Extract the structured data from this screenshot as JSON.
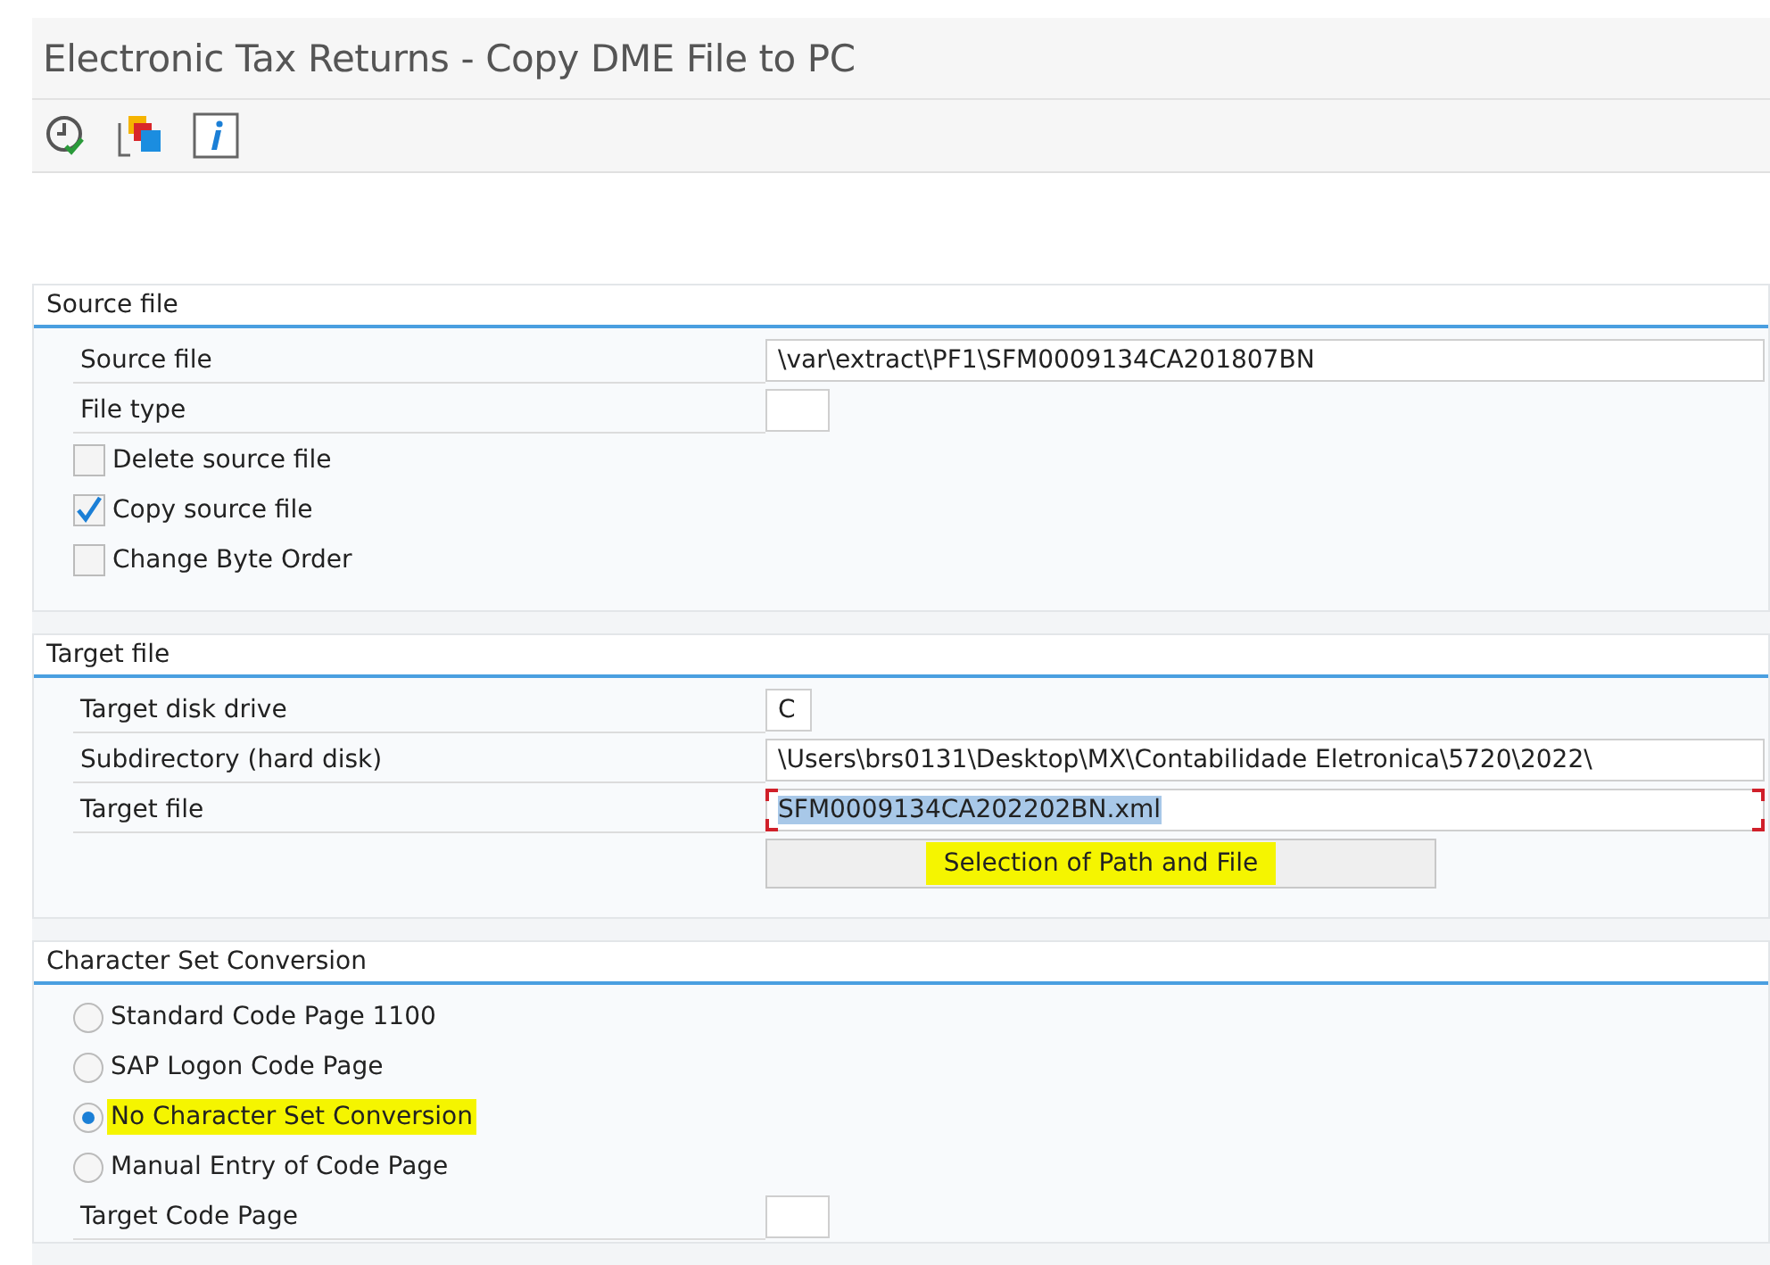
{
  "window": {
    "title": "Electronic Tax Returns - Copy DME File to PC"
  },
  "sections": [
    {
      "title": "Source file",
      "rows": [
        {
          "kind": "field",
          "label": "Source file",
          "value": "\\var\\extract\\PF1\\SFM0009134CA201807BN"
        },
        {
          "kind": "short_field",
          "label": "File type"
        },
        {
          "kind": "checkbox",
          "label": "Delete source file",
          "checked": false
        },
        {
          "kind": "checkbox",
          "label": "Copy source file",
          "checked": true
        },
        {
          "kind": "checkbox",
          "label": "Change Byte Order",
          "checked": false
        }
      ]
    },
    {
      "title": "Target file",
      "rows": [
        {
          "kind": "short_field",
          "label": "Target disk drive",
          "value": "C"
        },
        {
          "kind": "field",
          "label": "Subdirectory (hard disk)",
          "value": "\\Users\\brs0131\\Desktop\\MX\\Contabilidade Eletronica\\5720\\2022\\"
        },
        {
          "kind": "field",
          "label": "Target file",
          "value": "SFM0009134CA202202BN.xml",
          "focused": true
        },
        {
          "kind": "button",
          "label": "Selection of Path and File",
          "highlighted": true
        }
      ]
    },
    {
      "title": "Character Set Conversion",
      "rows": [
        {
          "kind": "radio",
          "label": "Standard Code Page 1100",
          "selected": false,
          "highlighted": false
        },
        {
          "kind": "radio",
          "label": "SAP Logon Code Page",
          "selected": false,
          "highlighted": false
        },
        {
          "kind": "radio",
          "label": "No Character Set Conversion",
          "selected": true,
          "highlighted": true
        },
        {
          "kind": "radio",
          "label": "Manual Entry of Code Page",
          "selected": false,
          "highlighted": false
        },
        {
          "kind": "short_field",
          "label": "Target Code Page"
        }
      ]
    }
  ]
}
